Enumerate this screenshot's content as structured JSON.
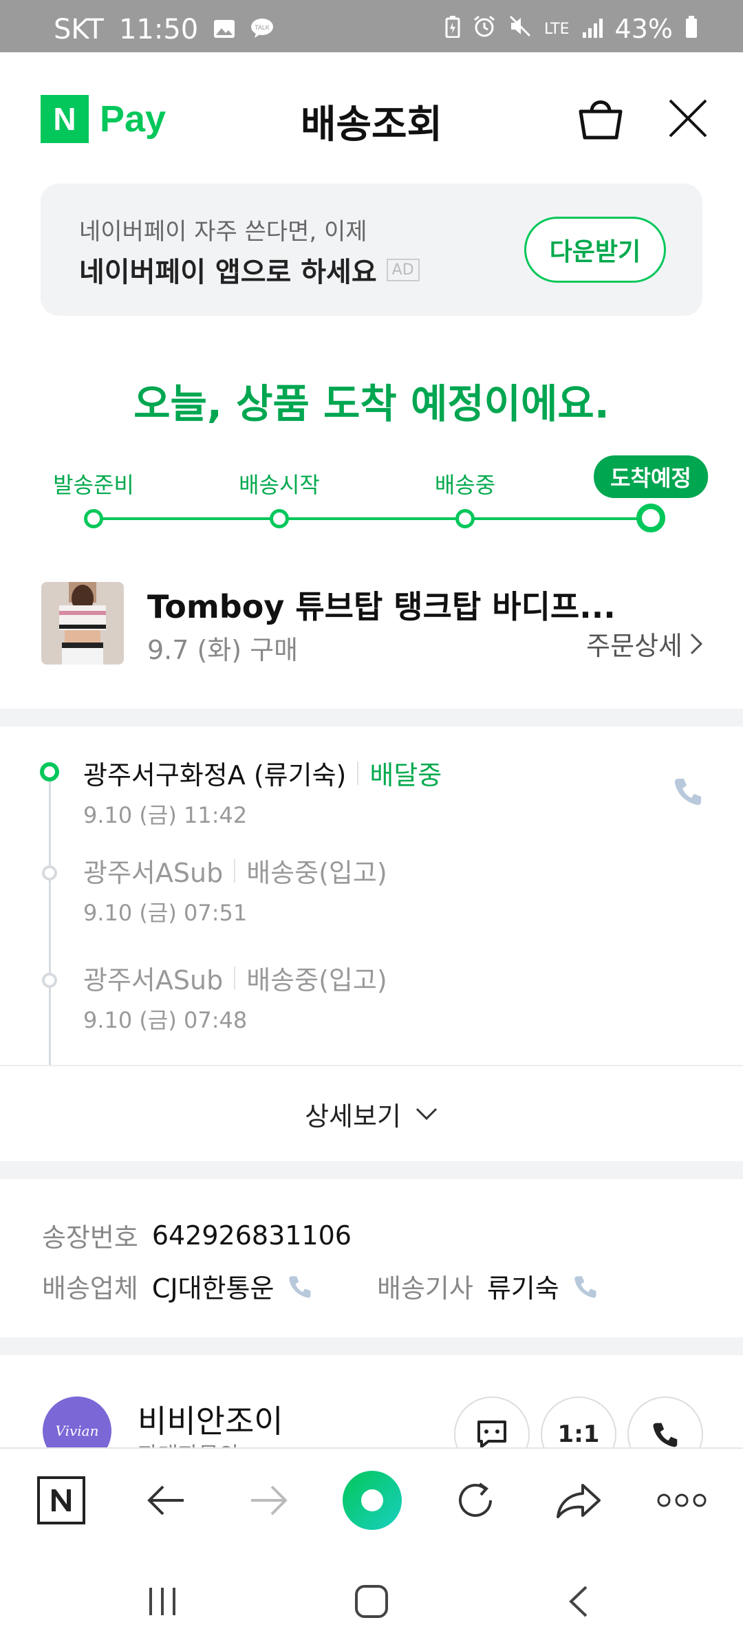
{
  "status_bar": {
    "carrier": "SKT",
    "time": "11:50",
    "network": "LTE",
    "battery": "43%"
  },
  "header": {
    "brand_n": "N",
    "brand_pay": "Pay",
    "title": "배송조회"
  },
  "ad": {
    "line1": "네이버페이 자주 쓴다면, 이제",
    "line2": "네이버페이 앱으로 하세요",
    "tag": "AD",
    "button": "다운받기"
  },
  "headline": "오늘, 상품 도착 예정이에요.",
  "progress": {
    "steps": [
      "발송준비",
      "배송시작",
      "배송중",
      "도착예정"
    ],
    "current_step": 3
  },
  "product": {
    "name": "Tomboy 튜브탑 탱크탑 바디프...",
    "purchase_date": "9.7 (화) 구매",
    "order_detail": "주문상세"
  },
  "tracking": [
    {
      "location": "광주서구화정A (류기숙)",
      "status": "배달중",
      "time": "9.10 (금) 11:42"
    },
    {
      "location": "광주서ASub",
      "status": "배송중(입고)",
      "time": "9.10 (금) 07:51"
    },
    {
      "location": "광주서ASub",
      "status": "배송중(입고)",
      "time": "9.10 (금) 07:48"
    }
  ],
  "more_label": "상세보기",
  "info": {
    "invoice_label": "송장번호",
    "invoice_value": "642926831106",
    "carrier_label": "배송업체",
    "carrier_value": "CJ대한통운",
    "driver_label": "배송기사",
    "driver_value": "류기숙"
  },
  "seller": {
    "name": "비비안조이",
    "subtitle": "판매자문의",
    "logo_text": "Vivian Joy",
    "chat_button": "1:1"
  },
  "colors": {
    "brand_green": "#03c75a",
    "headline_green": "#00a650",
    "status_bar": "#9b9b9b"
  }
}
